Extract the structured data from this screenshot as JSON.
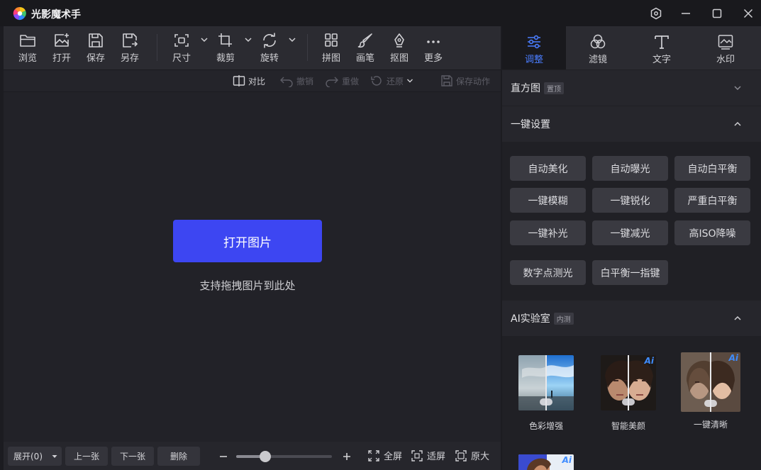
{
  "app": {
    "title": "光影魔术手"
  },
  "toolbar": {
    "browse": "浏览",
    "open": "打开",
    "save": "保存",
    "save_as": "另存",
    "size": "尺寸",
    "crop": "裁剪",
    "rotate": "旋转",
    "collage": "拼图",
    "brush": "画笔",
    "cutout": "抠图",
    "more": "更多"
  },
  "subbar": {
    "compare": "对比",
    "undo": "撤销",
    "redo": "重做",
    "restore": "还原",
    "save_action": "保存动作"
  },
  "canvas": {
    "open_button": "打开图片",
    "drag_hint": "支持拖拽图片到此处"
  },
  "bottom": {
    "expand": "展开(0)",
    "prev": "上一张",
    "next": "下一张",
    "delete": "删除",
    "fullscreen": "全屏",
    "fit": "适屏",
    "original": "原大",
    "zoom_level": 0.3
  },
  "right_tabs": [
    {
      "label": "调整",
      "active": true
    },
    {
      "label": "滤镜",
      "active": false
    },
    {
      "label": "文字",
      "active": false
    },
    {
      "label": "水印",
      "active": false
    }
  ],
  "sections": {
    "histogram": {
      "title": "直方图",
      "tag": "置顶"
    },
    "one_click": {
      "title": "一键设置"
    },
    "ai_lab": {
      "title": "AI实验室",
      "tag": "内测"
    }
  },
  "one_click_buttons": [
    "自动美化",
    "自动曝光",
    "自动白平衡",
    "一键模糊",
    "一键锐化",
    "严重白平衡",
    "一键补光",
    "一键减光",
    "高ISO降噪",
    "数字点测光",
    "白平衡一指键"
  ],
  "ai_items": [
    {
      "label": "色彩增强",
      "badge": ""
    },
    {
      "label": "智能美颜",
      "badge": "Ai"
    },
    {
      "label": "一键清晰",
      "badge": "Ai"
    },
    {
      "label": "",
      "badge": "Ai"
    }
  ],
  "colors": {
    "accent": "#3d46f2",
    "tab_active": "#4a7dff"
  }
}
